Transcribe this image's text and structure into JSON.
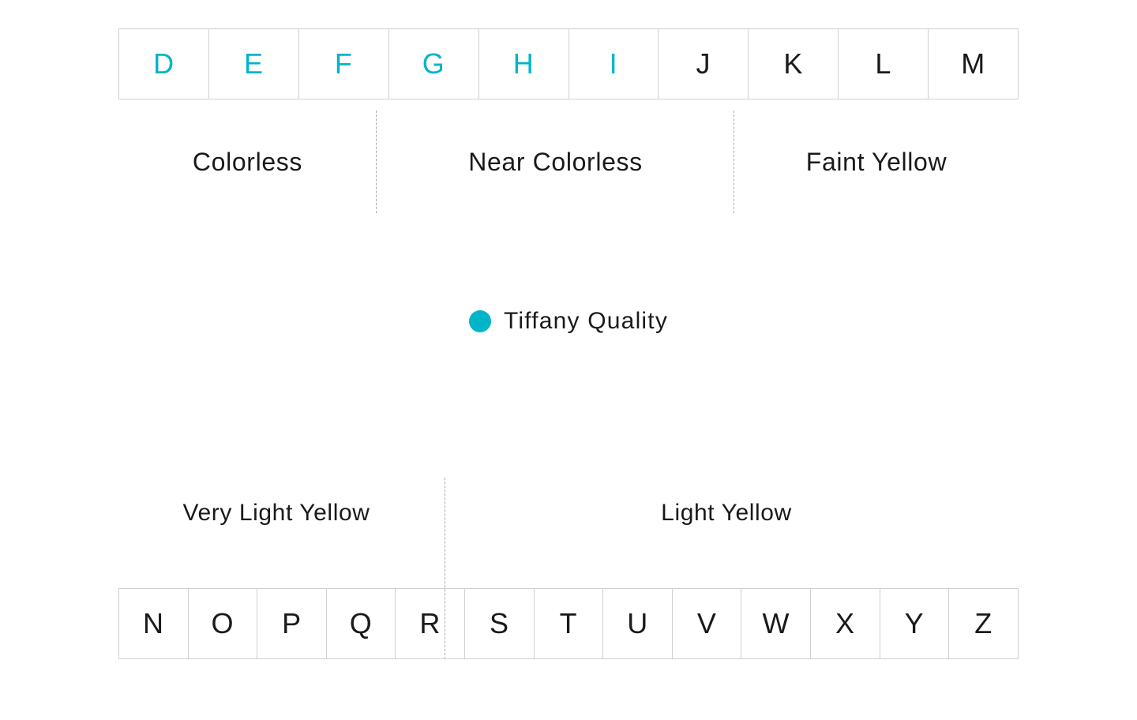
{
  "colors": {
    "tiffany": "#00b5c8",
    "text": "#1a1a1a",
    "border": "#d0d0d0",
    "dashed": "#aaaaaa"
  },
  "topGrades": [
    {
      "letter": "D",
      "tiffany": true
    },
    {
      "letter": "E",
      "tiffany": true
    },
    {
      "letter": "F",
      "tiffany": true
    },
    {
      "letter": "G",
      "tiffany": true
    },
    {
      "letter": "H",
      "tiffany": true
    },
    {
      "letter": "I",
      "tiffany": true
    },
    {
      "letter": "J",
      "tiffany": false
    },
    {
      "letter": "K",
      "tiffany": false
    },
    {
      "letter": "L",
      "tiffany": false
    },
    {
      "letter": "M",
      "tiffany": false
    }
  ],
  "topCategories": [
    {
      "label": "Colorless"
    },
    {
      "label": "Near Colorless"
    },
    {
      "label": "Faint Yellow"
    }
  ],
  "legend": {
    "label": "Tiffany Quality"
  },
  "bottomCategories": [
    {
      "label": "Very Light Yellow"
    },
    {
      "label": "Light Yellow"
    }
  ],
  "bottomGrades": [
    {
      "letter": "N"
    },
    {
      "letter": "O"
    },
    {
      "letter": "P"
    },
    {
      "letter": "Q"
    },
    {
      "letter": "R"
    },
    {
      "letter": "S"
    },
    {
      "letter": "T"
    },
    {
      "letter": "U"
    },
    {
      "letter": "V"
    },
    {
      "letter": "W"
    },
    {
      "letter": "X"
    },
    {
      "letter": "Y"
    },
    {
      "letter": "Z"
    }
  ]
}
